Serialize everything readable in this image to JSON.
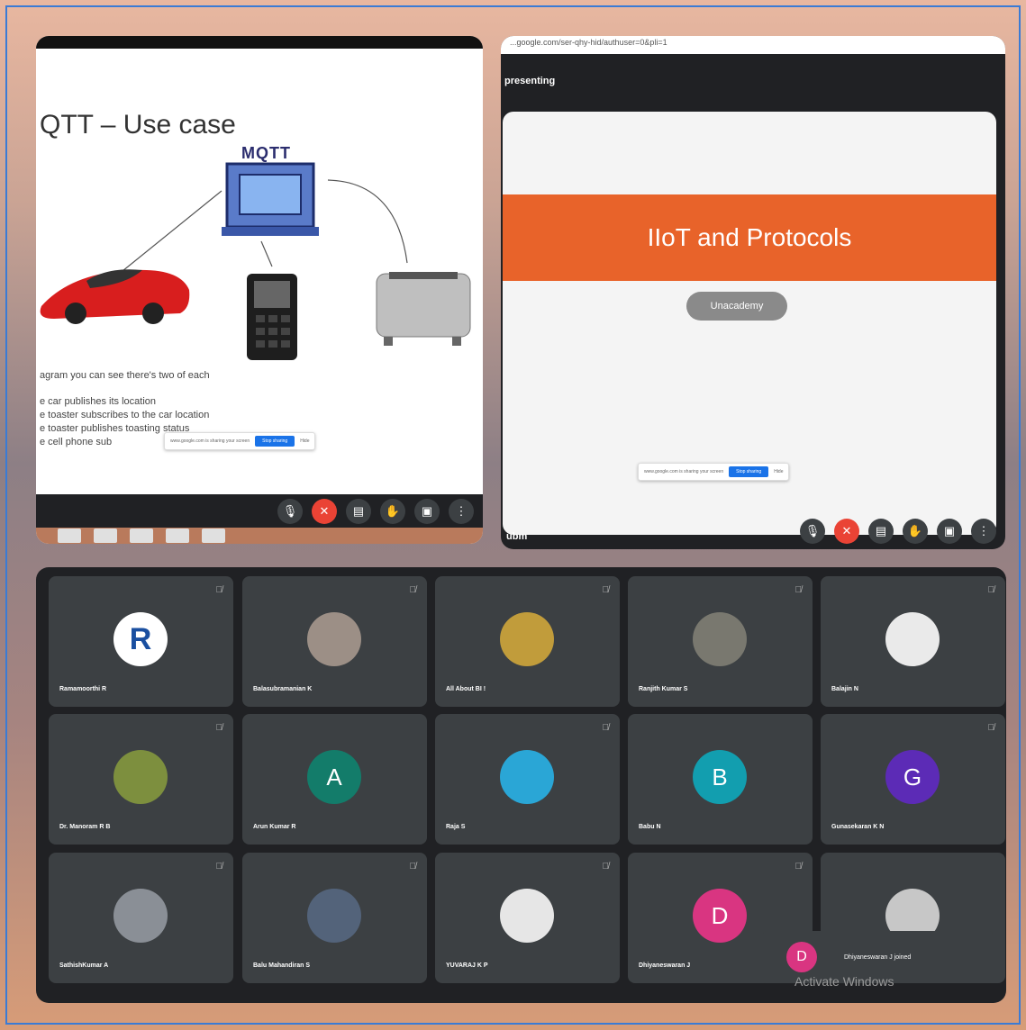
{
  "left_share": {
    "slide_title": "QTT – Use case",
    "logo_text": "MQTT",
    "bullet_intro": "agram you can see there's two of each",
    "bullets": [
      "e car publishes its location",
      "e toaster subscribes to the car location",
      "e toaster publishes toasting status",
      "e cell phone sub"
    ],
    "share_banner": {
      "text": "www.google.com is sharing your screen",
      "stop": "Stop sharing",
      "hide": "Hide"
    }
  },
  "right_share": {
    "url": "...google.com/ser-qhy-hid/authuser=0&pli=1",
    "presenting": "presenting",
    "slide_band": "IIoT and Protocols",
    "pill_text": "Unacademy",
    "share_banner": {
      "text": "www.google.com is sharing your screen",
      "stop": "Stop sharing",
      "hide": "Hide"
    },
    "presenter_name": "ubm"
  },
  "participants": [
    {
      "name": "Ramamoorthi R",
      "initial": "R",
      "color": "#ffffff",
      "fg": "#1a4fa0"
    },
    {
      "name": "Balasubramanian K",
      "initial": "",
      "color": "#9c8f86"
    },
    {
      "name": "All About BI !",
      "initial": "",
      "color": "#c19c3b"
    },
    {
      "name": "Ranjith Kumar S",
      "initial": "",
      "color": "#79786f"
    },
    {
      "name": "Balajin N",
      "initial": "",
      "color": "#eaeaea"
    },
    {
      "name": "Dr. Manoram R B",
      "initial": "",
      "color": "#7d8f3e"
    },
    {
      "name": "Arun Kumar R",
      "initial": "A",
      "color": "#137c6a"
    },
    {
      "name": "Raja S",
      "initial": "",
      "color": "#2aa6d6"
    },
    {
      "name": "Babu N",
      "initial": "B",
      "color": "#129eaf"
    },
    {
      "name": "Gunasekaran K N",
      "initial": "G",
      "color": "#5c2bb6"
    },
    {
      "name": "SathishKumar A",
      "initial": "",
      "color": "#8a8f96"
    },
    {
      "name": "Balu Mahandiran S",
      "initial": "",
      "color": "#53637a"
    },
    {
      "name": "YUVARAJ K P",
      "initial": "",
      "color": "#e6e6e6"
    },
    {
      "name": "Dhiyaneswaran J",
      "initial": "D",
      "color": "#d93581"
    },
    {
      "name": "",
      "initial": "",
      "color": "#c7c7c7"
    }
  ],
  "toast": {
    "initial": "D",
    "message": "Dhiyaneswaran J joined"
  },
  "watermark": "Activate Windows"
}
